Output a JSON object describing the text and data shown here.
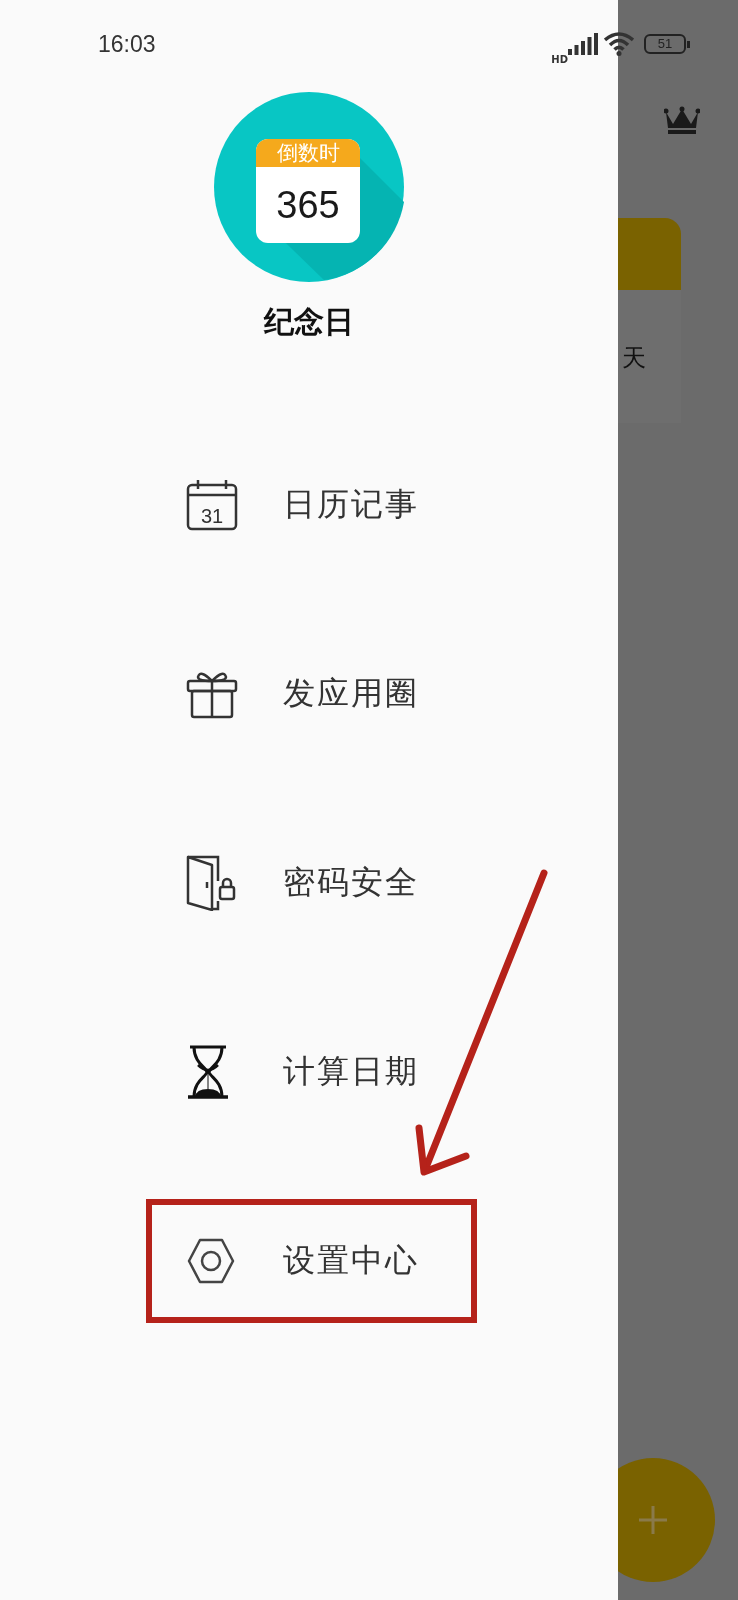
{
  "status_bar": {
    "time": "16:03",
    "network": "HD",
    "battery": "51"
  },
  "app": {
    "icon_header": "倒数时",
    "icon_number": "365",
    "name": "纪念日"
  },
  "menu": [
    {
      "kind": "calendar",
      "icon_text": "31",
      "label": "日历记事",
      "highlighted": false
    },
    {
      "kind": "gift",
      "label": "发应用圈",
      "highlighted": false
    },
    {
      "kind": "door-lock",
      "label": "密码安全",
      "highlighted": false
    },
    {
      "kind": "hourglass",
      "label": "计算日期",
      "highlighted": false
    },
    {
      "kind": "settings",
      "label": "设置中心",
      "highlighted": true
    }
  ],
  "background": {
    "card_text": "天"
  }
}
